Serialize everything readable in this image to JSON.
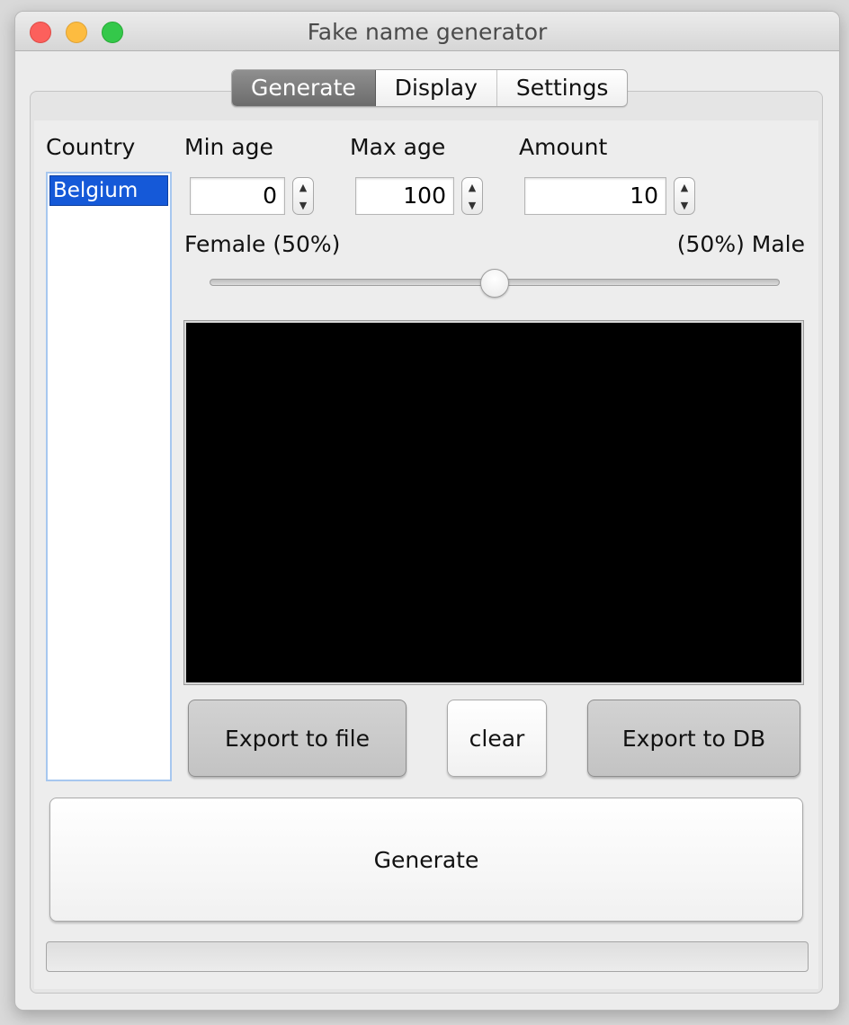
{
  "window": {
    "title": "Fake name generator"
  },
  "tabs": [
    {
      "label": "Generate",
      "active": true
    },
    {
      "label": "Display",
      "active": false
    },
    {
      "label": "Settings",
      "active": false
    }
  ],
  "country": {
    "label": "Country",
    "items": [
      "Belgium"
    ],
    "selected": "Belgium"
  },
  "min_age": {
    "label": "Min age",
    "value": "0"
  },
  "max_age": {
    "label": "Max age",
    "value": "100"
  },
  "amount": {
    "label": "Amount",
    "value": "10"
  },
  "gender_slider": {
    "left_label": "Female (50%)",
    "right_label": "(50%) Male",
    "value_fraction": 0.5
  },
  "buttons": {
    "export_file": "Export to file",
    "clear": "clear",
    "export_db": "Export to DB",
    "generate": "Generate"
  },
  "progress": {
    "value_fraction": 0
  },
  "colors": {
    "selection": "#1559d8",
    "output_bg": "#000000",
    "accent_tab": "#7a7a7a"
  }
}
